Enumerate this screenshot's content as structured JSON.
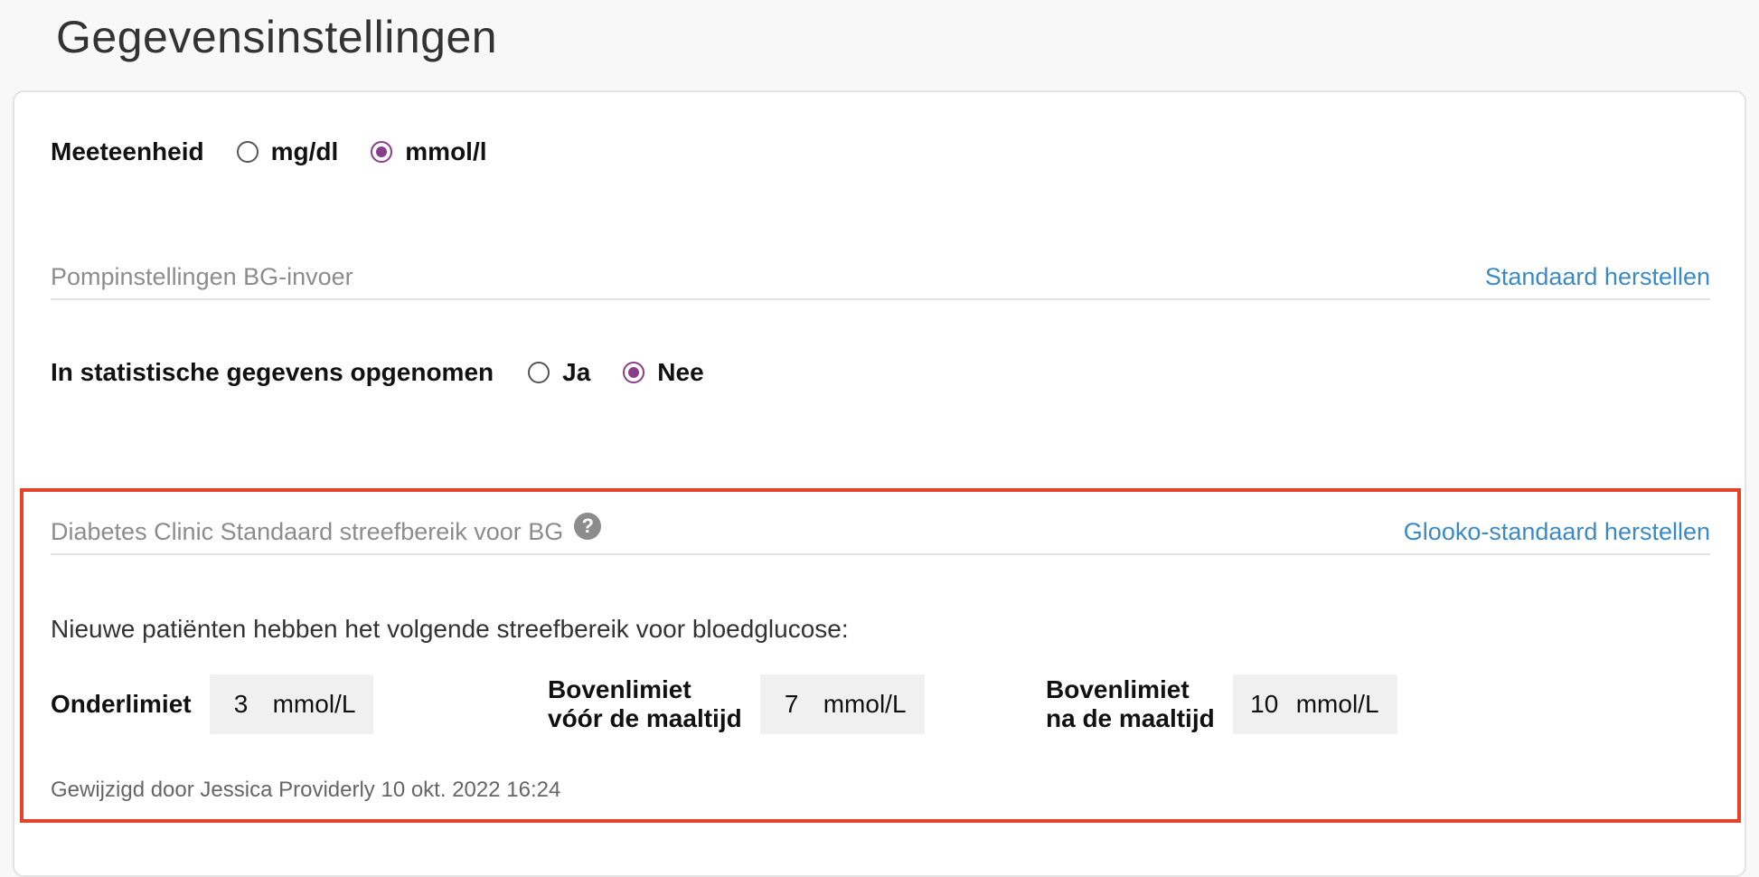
{
  "page": {
    "title": "Gegevensinstellingen"
  },
  "unit_setting": {
    "label": "Meeteenheid",
    "options": [
      {
        "label": "mg/dl",
        "checked": false
      },
      {
        "label": "mmol/l",
        "checked": true
      }
    ]
  },
  "pump_section": {
    "title": "Pompinstellingen BG-invoer",
    "reset_link": "Standaard herstellen"
  },
  "statistics_setting": {
    "label": "In statistische gegevens opgenomen",
    "options": [
      {
        "label": "Ja",
        "checked": false
      },
      {
        "label": "Nee",
        "checked": true
      }
    ]
  },
  "target_section": {
    "title": "Diabetes Clinic Standaard streefbereik voor BG",
    "help_icon": "?",
    "reset_link": "Glooko-standaard herstellen",
    "description": "Nieuwe patiënten hebben het volgende streefbereik voor bloedglucose:",
    "limits": {
      "lower": {
        "label": "Onderlimiet",
        "value": "3",
        "unit": "mmol/L"
      },
      "upper_before": {
        "label_line1": "Bovenlimiet",
        "label_line2": "vóór de maaltijd",
        "value": "7",
        "unit": "mmol/L"
      },
      "upper_after": {
        "label_line1": "Bovenlimiet",
        "label_line2": "na de maaltijd",
        "value": "10",
        "unit": "mmol/L"
      }
    },
    "modified_by": "Gewijzigd door Jessica Providerly 10 okt. 2022 16:24"
  },
  "colors": {
    "accent": "#8a3d8a",
    "link": "#3a8ac8",
    "highlight": "#e5422a"
  }
}
